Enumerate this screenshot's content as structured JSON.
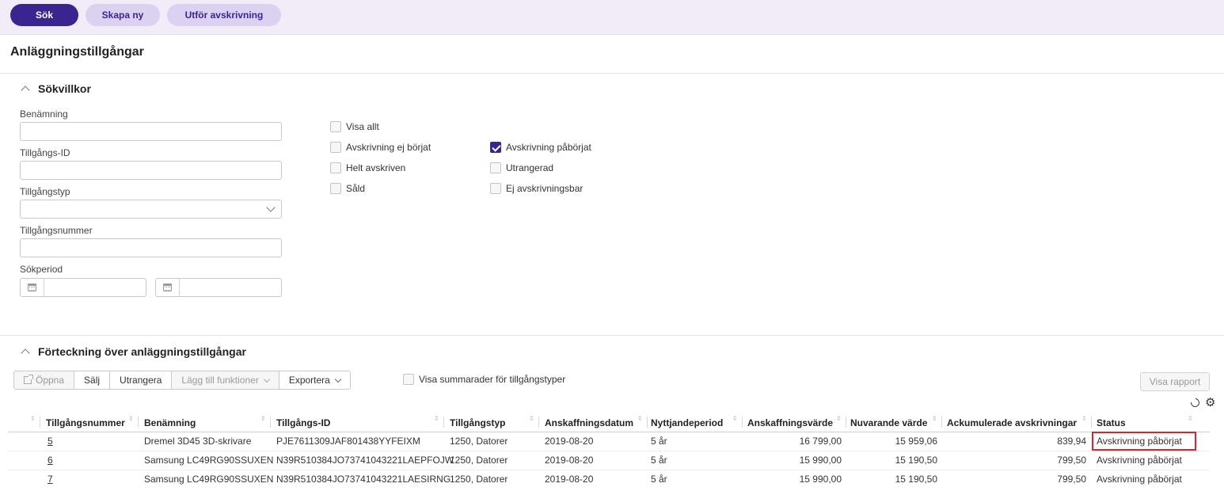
{
  "toolbar": {
    "buttons": [
      "Sök",
      "Skapa ny",
      "Utför avskrivning"
    ]
  },
  "page": {
    "title": "Anläggningstillgångar"
  },
  "search": {
    "title": "Sökvillkor",
    "fields": {
      "name_label": "Benämning",
      "asset_id_label": "Tillgångs-ID",
      "asset_type_label": "Tillgångstyp",
      "asset_number_label": "Tillgångsnummer",
      "period_label": "Sökperiod"
    },
    "checkboxes": [
      {
        "label": "Visa allt",
        "checked": false
      },
      {
        "label": "Avskrivning ej börjat",
        "checked": false
      },
      {
        "label": "Helt avskriven",
        "checked": false
      },
      {
        "label": "Såld",
        "checked": false
      },
      {
        "label": "Avskrivning påbörjat",
        "checked": true
      },
      {
        "label": "Utrangerad",
        "checked": false
      },
      {
        "label": "Ej avskrivningsbar",
        "checked": false
      }
    ]
  },
  "list": {
    "title": "Förteckning över anläggningstillgångar",
    "actions": [
      "Öppna",
      "Sälj",
      "Utrangera",
      "Lägg till funktioner",
      "Exportera"
    ],
    "summary_label": "Visa summarader för tillgångstyper",
    "report_label": "Visa rapport",
    "columns": [
      "Tillgångsnummer",
      "Benämning",
      "Tillgångs-ID",
      "Tillgångstyp",
      "Anskaffningsdatum",
      "Nyttjandeperiod",
      "Anskaffningsvärde",
      "Nuvarande värde",
      "Ackumulerade avskrivningar",
      "Status"
    ],
    "rows": [
      [
        "5",
        "Dremel 3D45 3D-skrivare",
        "PJE7611309JAF801438YYFEIXM",
        "1250, Datorer",
        "2019-08-20",
        "5 år",
        "16 799,00",
        "15 959,06",
        "839,94",
        "Avskrivning påbörjat"
      ],
      [
        "6",
        "Samsung LC49RG90SSUXEN",
        "N39R510384JO73741043221LAEPFOJW",
        "1250, Datorer",
        "2019-08-20",
        "5 år",
        "15 990,00",
        "15 190,50",
        "799,50",
        "Avskrivning påbörjat"
      ],
      [
        "7",
        "Samsung LC49RG90SSUXEN",
        "N39R510384JO73741043221LAESIRNG",
        "1250, Datorer",
        "2019-08-20",
        "5 år",
        "15 990,00",
        "15 190,50",
        "799,50",
        "Avskrivning påbörjat"
      ]
    ]
  },
  "colors": {
    "primary": "#3a2490",
    "secondary": "#ddd1f2",
    "topbar": "#f1ecf8",
    "highlight": "#d9262c"
  }
}
